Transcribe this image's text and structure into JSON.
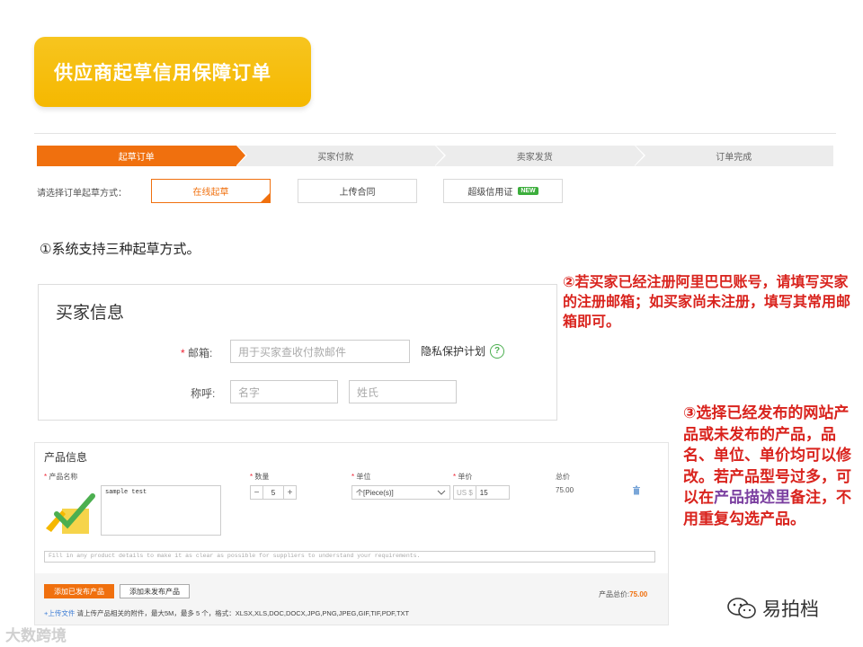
{
  "title": "供应商起草信用保障订单",
  "steps": [
    "起草订单",
    "买家付款",
    "卖家发货",
    "订单完成"
  ],
  "method": {
    "label": "请选择订单起草方式：",
    "options": [
      "在线起草",
      "上传合同",
      "超级信用证"
    ],
    "new_badge": "NEW"
  },
  "note1": "①系统支持三种起草方式。",
  "buyer": {
    "title": "买家信息",
    "email_label": "邮箱:",
    "email_required": "*",
    "email_placeholder": "用于买家查收付款邮件",
    "privacy": "隐私保护计划",
    "help": "?",
    "name_label": "称呼:",
    "first_placeholder": "名字",
    "last_placeholder": "姓氏"
  },
  "annotation2": "②若买家已经注册阿里巴巴账号，请填写买家的注册邮箱；如买家尚未注册，填写其常用邮箱即可。",
  "annotation3": {
    "part1": "③选择已经发布的网站产品或未发布的产品，品名、单位、单价均可以修改。若产品型号过多，可以在",
    "highlight": "产品描述里",
    "part2": "备注，不用重复勾选产品。"
  },
  "product": {
    "title": "产品信息",
    "col_name": "产品名称",
    "col_qty": "数量",
    "col_unit": "单位",
    "col_price": "单价",
    "col_total": "总价",
    "name_value": "sample test",
    "qty": "5",
    "minus": "−",
    "plus": "+",
    "unit": "个[Piece(s)]",
    "currency": "US $",
    "price": "15",
    "total": "75.00",
    "details_placeholder": "Fill in any product details to make it as clear as possible for suppliers to understand your requirements.",
    "add_published": "添加已发布产品",
    "add_unpublished": "添加未发布产品",
    "grand_total_label": "产品总价:",
    "grand_total_value": "75.00",
    "upload_link": "+上传文件",
    "upload_hint": "请上传产品相关的附件，最大5M，最多 5 个，格式：XLSX,XLS,DOC,DOCX,JPG,PNG,JPEG,GIF,TIF,PDF,TXT"
  },
  "watermark_left": "大数跨境",
  "watermark_right": "易拍档",
  "colors": {
    "accent": "#f0700e",
    "banner": "#f5b800",
    "annotation": "#d9231d"
  }
}
